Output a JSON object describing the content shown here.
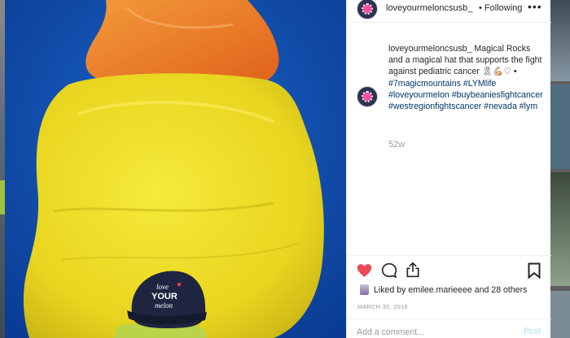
{
  "post": {
    "username": "loveyourmeloncsusb_",
    "separator": "•",
    "following_label": "Following",
    "more_label": "•••"
  },
  "caption": {
    "username": "loveyourmeloncsusb_",
    "text": "Magical Rocks and a magical hat that supports the fight against pediatric cancer 🎗💪🏼♡ •",
    "hashtags": "#7magicmountains #LYMlife #loveyourmelon #buybeaniesfightcancer #westregionfightscancer #nevada #lym",
    "age": "52w"
  },
  "likes": {
    "prefix": "Liked by ",
    "user": "emilee.marieeee",
    "middle": " and ",
    "others": "28 others"
  },
  "date": "MARCH 30, 2018",
  "comment_box": {
    "placeholder": "Add a comment...",
    "post_label": "Post"
  },
  "photo": {
    "hat_text_line1": "love",
    "hat_text_line2": "YOUR",
    "hat_text_line3": "melon"
  },
  "icons": {
    "like": "heart-icon",
    "comment": "comment-icon",
    "share": "share-icon",
    "save": "bookmark-icon",
    "more": "more-icon"
  },
  "colors": {
    "heart": "#ed4956",
    "link": "#003569",
    "muted": "#999999",
    "post_button": "#b2dffc",
    "rock_yellow": "#f3e12a",
    "rock_orange": "#f07a1f",
    "sky": "#0e4aa8"
  }
}
